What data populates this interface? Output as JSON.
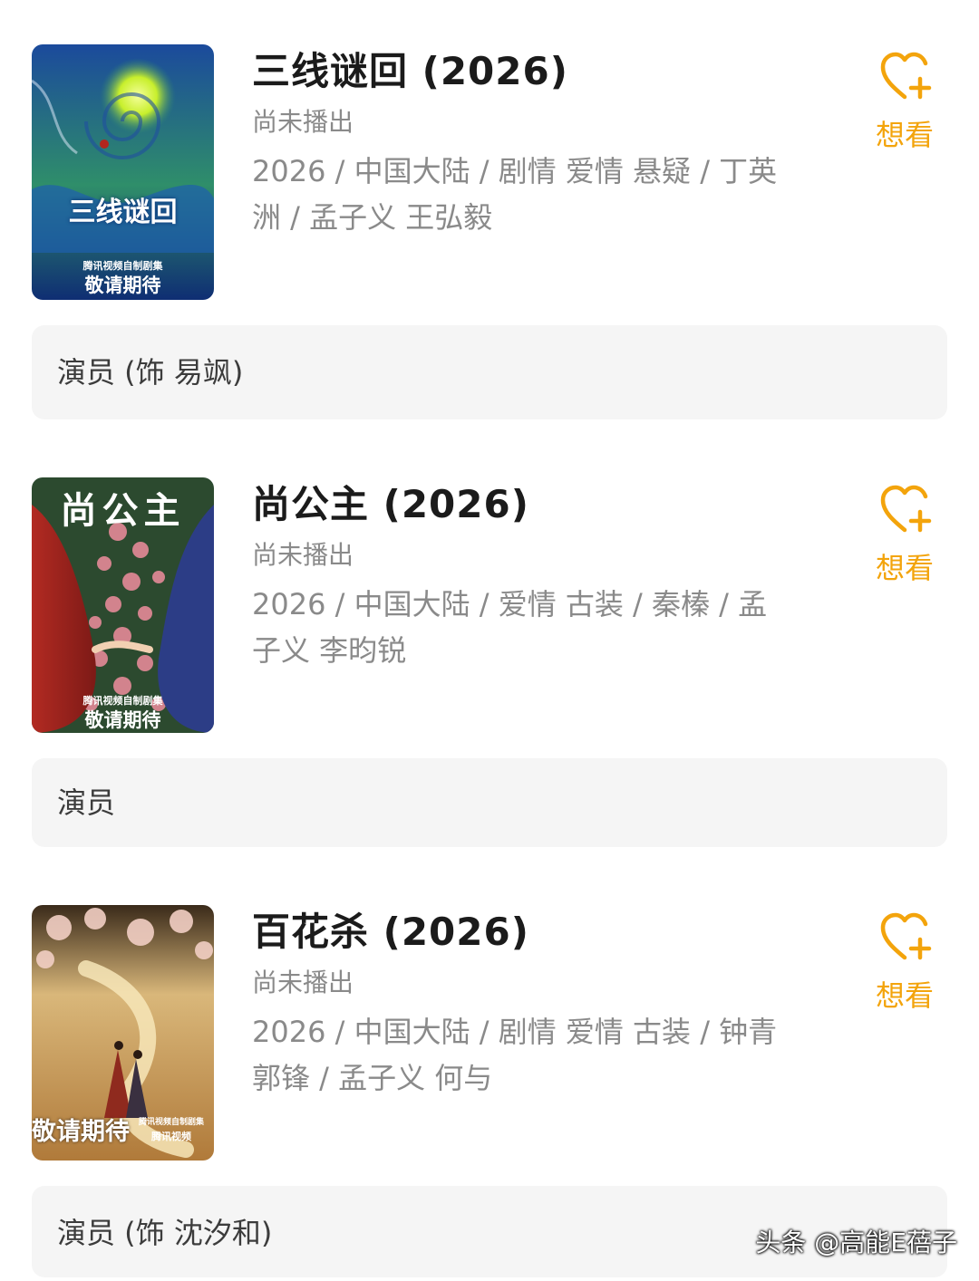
{
  "entries": [
    {
      "title": "三线谜回 (2026)",
      "status": "尚未播出",
      "meta": "2026 / 中国大陆 / 剧情 爱情 悬疑 / 丁英洲 / 孟子义 王弘毅",
      "want_label": "想看",
      "actor_label": "演员 (饰 易飒)",
      "poster": {
        "logo": "三线谜回",
        "tag": "腾讯视频自制剧集",
        "tagline": "敬请期待",
        "colors": {
          "top": "#1b4a9c",
          "mid": "#2f8e6a",
          "bottom": "#0f2e73",
          "swirl": "#c8ef2c"
        }
      }
    },
    {
      "title": "尚公主 (2026)",
      "status": "尚未播出",
      "meta": "2026 / 中国大陆 / 爱情 古装 / 秦榛 / 孟子义 李昀锐",
      "want_label": "想看",
      "actor_label": "演员",
      "poster": {
        "logo": "尚公主",
        "tag": "腾讯视频自制剧集",
        "tagline": "敬请期待",
        "colors": {
          "left": "#b22a22",
          "right": "#2c3d86",
          "flowers": "#e58a98",
          "leaves": "#3f6b3a"
        }
      }
    },
    {
      "title": "百花杀 (2026)",
      "status": "尚未播出",
      "meta": "2026 / 中国大陆 / 剧情 爱情 古装 / 钟青 郭锋 / 孟子义 何与",
      "want_label": "想看",
      "actor_label": "演员 (饰 沈汐和)",
      "poster": {
        "tag": "腾讯视频自制剧集",
        "tagline": "敬请期待",
        "platform": "腾讯视频",
        "colors": {
          "sky": "#d9b77a",
          "ground": "#b07a3a",
          "blossom": "#f2cfc4",
          "figure": "#8f2a1e"
        }
      }
    }
  ],
  "watermark": "头条 @高能E蓓子",
  "accent_color": "#f3a40c",
  "icons": {
    "want": "heart-plus-icon"
  }
}
